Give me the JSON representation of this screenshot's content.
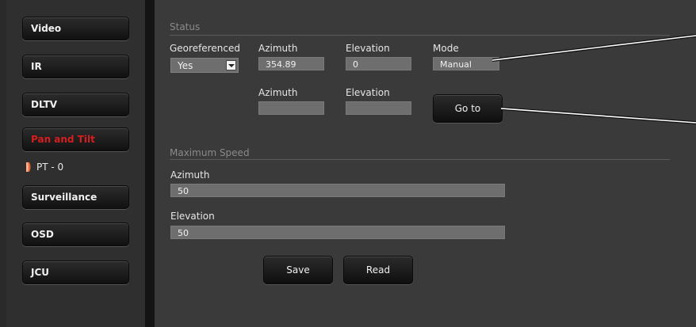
{
  "sidebar": {
    "items": [
      {
        "label": "Video"
      },
      {
        "label": "IR"
      },
      {
        "label": "DLTV"
      },
      {
        "label": "Pan and Tilt",
        "active": true
      },
      {
        "label": "Surveillance"
      },
      {
        "label": "OSD"
      },
      {
        "label": "JCU"
      }
    ],
    "subitem": {
      "label": "PT - 0"
    }
  },
  "status": {
    "title": "Status",
    "georeferenced_label": "Georeferenced",
    "georeferenced_value": "Yes",
    "azimuth_label": "Azimuth",
    "azimuth_value": "354.89",
    "elevation_label": "Elevation",
    "elevation_value": "0",
    "mode_label": "Mode",
    "mode_value": "Manual",
    "goto_azimuth_label": "Azimuth",
    "goto_azimuth_value": "",
    "goto_elevation_label": "Elevation",
    "goto_elevation_value": "",
    "goto_button": "Go to"
  },
  "max_speed": {
    "title": "Maximum Speed",
    "azimuth_label": "Azimuth",
    "azimuth_value": "50",
    "elevation_label": "Elevation",
    "elevation_value": "50"
  },
  "actions": {
    "save": "Save",
    "read": "Read"
  },
  "colors": {
    "active_nav": "#d61e1e",
    "background": "#3a3a3a",
    "field": "#6e6e6e"
  }
}
